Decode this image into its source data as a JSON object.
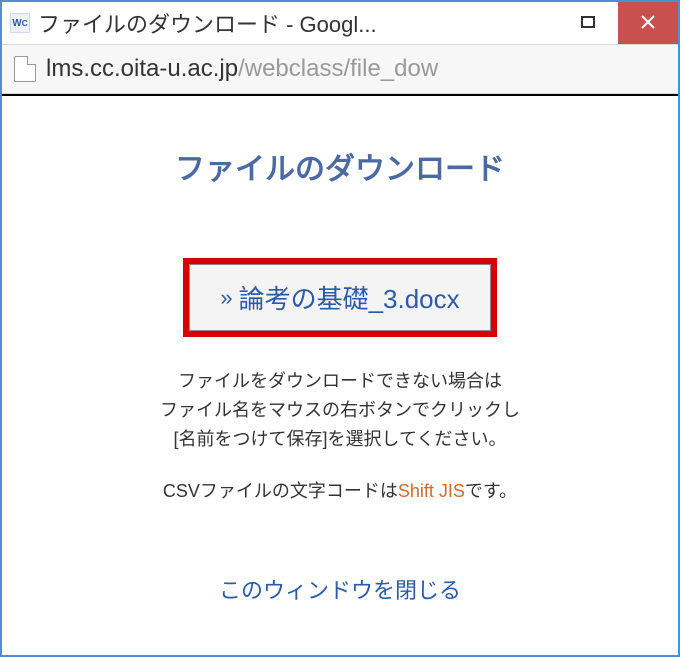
{
  "window": {
    "title": "ファイルのダウンロード - Googl..."
  },
  "addressbar": {
    "domain": "lms.cc.oita-u.ac.jp",
    "path": "/webclass/file_dow"
  },
  "page": {
    "heading": "ファイルのダウンロード",
    "file_name": "論考の基礎_3.docx",
    "help_line1": "ファイルをダウンロードできない場合は",
    "help_line2": "ファイル名をマウスの右ボタンでクリックし",
    "help_line3": "[名前をつけて保存]を選択してください。",
    "csv_prefix": "CSVファイルの文字コードは",
    "csv_encoding": "Shift JIS",
    "csv_suffix": "です。",
    "close_link": "このウィンドウを閉じる"
  }
}
